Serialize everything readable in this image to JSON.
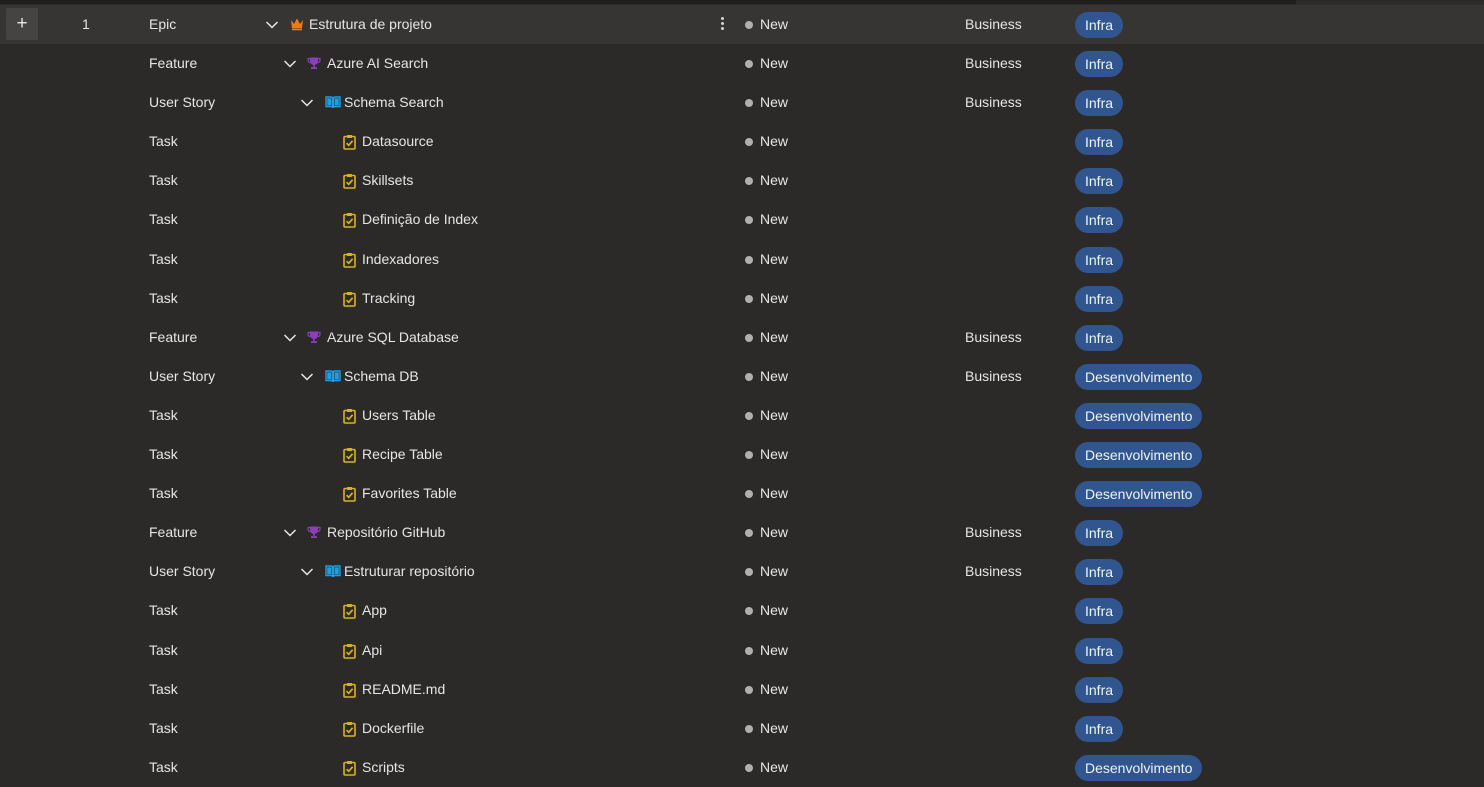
{
  "add_label": "+",
  "colors": {
    "background": "#2b2a29",
    "selected_row": "#363534",
    "tag_background": "#30558f",
    "epic_icon": "#f07b15",
    "feature_icon": "#8b3fb8",
    "story_icon": "#1f9ee0",
    "task_icon": "#d8b41c",
    "state_new": "#b2b0ad"
  },
  "rows": [
    {
      "order": "1",
      "type": "Epic",
      "title": "Estrutura de projeto",
      "state": "New",
      "area": "Business",
      "tag": "Infra",
      "icon": "crown-icon",
      "expandable": true
    },
    {
      "order": "",
      "type": "Feature",
      "title": "Azure AI Search",
      "state": "New",
      "area": "Business",
      "tag": "Infra",
      "icon": "trophy-icon",
      "expandable": true
    },
    {
      "order": "",
      "type": "User Story",
      "title": "Schema Search",
      "state": "New",
      "area": "Business",
      "tag": "Infra",
      "icon": "book-icon",
      "expandable": true
    },
    {
      "order": "",
      "type": "Task",
      "title": "Datasource",
      "state": "New",
      "area": "",
      "tag": "Infra",
      "icon": "clipboard-check-icon",
      "expandable": false
    },
    {
      "order": "",
      "type": "Task",
      "title": "Skillsets",
      "state": "New",
      "area": "",
      "tag": "Infra",
      "icon": "clipboard-check-icon",
      "expandable": false
    },
    {
      "order": "",
      "type": "Task",
      "title": "Definição de Index",
      "state": "New",
      "area": "",
      "tag": "Infra",
      "icon": "clipboard-check-icon",
      "expandable": false
    },
    {
      "order": "",
      "type": "Task",
      "title": "Indexadores",
      "state": "New",
      "area": "",
      "tag": "Infra",
      "icon": "clipboard-check-icon",
      "expandable": false
    },
    {
      "order": "",
      "type": "Task",
      "title": "Tracking",
      "state": "New",
      "area": "",
      "tag": "Infra",
      "icon": "clipboard-check-icon",
      "expandable": false
    },
    {
      "order": "",
      "type": "Feature",
      "title": "Azure SQL Database",
      "state": "New",
      "area": "Business",
      "tag": "Infra",
      "icon": "trophy-icon",
      "expandable": true
    },
    {
      "order": "",
      "type": "User Story",
      "title": "Schema DB",
      "state": "New",
      "area": "Business",
      "tag": "Desenvolvimento",
      "icon": "book-icon",
      "expandable": true
    },
    {
      "order": "",
      "type": "Task",
      "title": "Users Table",
      "state": "New",
      "area": "",
      "tag": "Desenvolvimento",
      "icon": "clipboard-check-icon",
      "expandable": false
    },
    {
      "order": "",
      "type": "Task",
      "title": "Recipe Table",
      "state": "New",
      "area": "",
      "tag": "Desenvolvimento",
      "icon": "clipboard-check-icon",
      "expandable": false
    },
    {
      "order": "",
      "type": "Task",
      "title": "Favorites Table",
      "state": "New",
      "area": "",
      "tag": "Desenvolvimento",
      "icon": "clipboard-check-icon",
      "expandable": false
    },
    {
      "order": "",
      "type": "Feature",
      "title": "Repositório GitHub",
      "state": "New",
      "area": "Business",
      "tag": "Infra",
      "icon": "trophy-icon",
      "expandable": true
    },
    {
      "order": "",
      "type": "User Story",
      "title": "Estruturar repositório",
      "state": "New",
      "area": "Business",
      "tag": "Infra",
      "icon": "book-icon",
      "expandable": true
    },
    {
      "order": "",
      "type": "Task",
      "title": "App",
      "state": "New",
      "area": "",
      "tag": "Infra",
      "icon": "clipboard-check-icon",
      "expandable": false
    },
    {
      "order": "",
      "type": "Task",
      "title": "Api",
      "state": "New",
      "area": "",
      "tag": "Infra",
      "icon": "clipboard-check-icon",
      "expandable": false
    },
    {
      "order": "",
      "type": "Task",
      "title": "README.md",
      "state": "New",
      "area": "",
      "tag": "Infra",
      "icon": "clipboard-check-icon",
      "expandable": false
    },
    {
      "order": "",
      "type": "Task",
      "title": "Dockerfile",
      "state": "New",
      "area": "",
      "tag": "Infra",
      "icon": "clipboard-check-icon",
      "expandable": false
    },
    {
      "order": "",
      "type": "Task",
      "title": "Scripts",
      "state": "New",
      "area": "",
      "tag": "Desenvolvimento",
      "icon": "clipboard-check-icon",
      "expandable": false
    }
  ]
}
